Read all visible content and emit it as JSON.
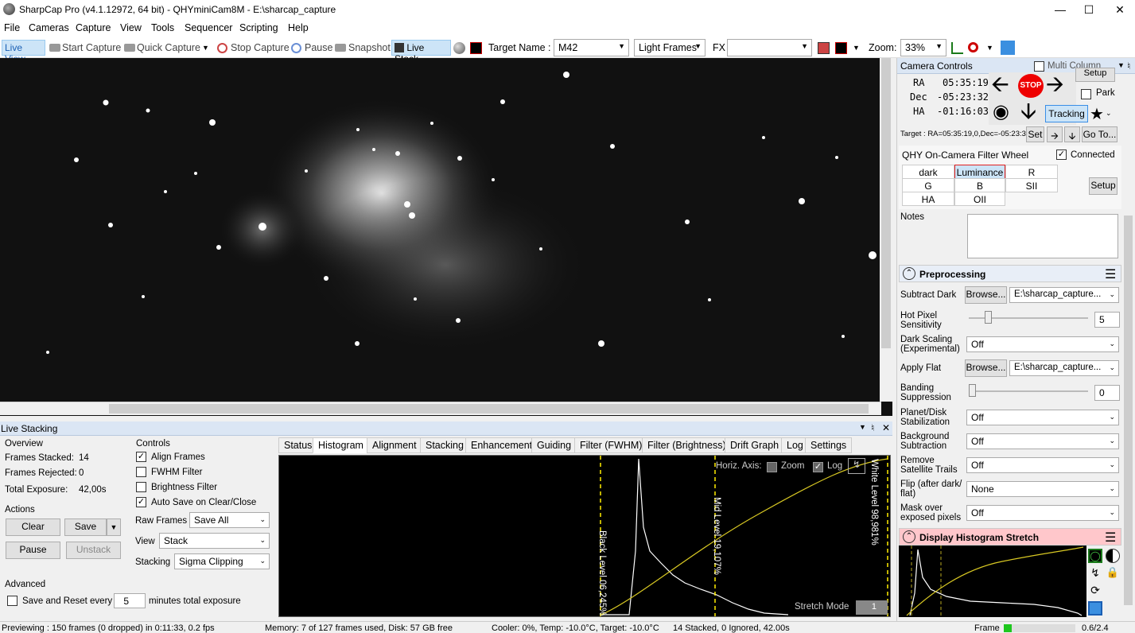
{
  "window": {
    "title": "SharpCap Pro (v4.1.12972, 64 bit) - QHYminiCam8M - E:\\sharcap_capture"
  },
  "menu": [
    "File",
    "Cameras",
    "Capture",
    "View",
    "Tools",
    "Sequencer",
    "Scripting",
    "Help"
  ],
  "toolbar": {
    "live_view": "Live View",
    "start_capture": "Start Capture",
    "quick_capture": "Quick Capture",
    "stop_capture": "Stop Capture",
    "pause": "Pause",
    "snapshot": "Snapshot",
    "live_stack": "Live Stack",
    "target_label": "Target Name :",
    "target_value": "M42",
    "frame_type": "Light Frames",
    "fx_label": "FX",
    "fx_value": "",
    "zoom_label": "Zoom:",
    "zoom_value": "33%"
  },
  "camera_controls": {
    "title": "Camera Controls",
    "multi_column": "Multi Column",
    "ra_label": "RA",
    "ra": "05:35:19",
    "dec_label": "Dec",
    "dec": "-05:23:32",
    "ha_label": "HA",
    "ha": "-01:16:03",
    "stop": "STOP",
    "setup": "Setup",
    "park": "Park",
    "tracking": "Tracking",
    "target": "Target : RA=05:35:19,0,Dec=-05:23:32",
    "set": "Set",
    "goto": "Go To..."
  },
  "filter_wheel": {
    "title": "QHY On-Camera Filter Wheel",
    "connected": "Connected",
    "setup": "Setup",
    "filters": [
      "dark",
      "Luminance",
      "R",
      "G",
      "B",
      "SII",
      "HA",
      "OII"
    ],
    "selected": "Luminance"
  },
  "notes": {
    "label": "Notes"
  },
  "preprocessing": {
    "title": "Preprocessing",
    "subtract_dark_label": "Subtract Dark",
    "browse": "Browse...",
    "dark_path": "E:\\sharcap_capture...",
    "hot_pixel_label": "Hot Pixel Sensitivity",
    "hot_pixel_value": "5",
    "dark_scaling_label": "Dark Scaling (Experimental)",
    "dark_scaling": "Off",
    "apply_flat_label": "Apply Flat",
    "flat_path": "E:\\sharcap_capture...",
    "banding_label": "Banding Suppression",
    "banding_value": "0",
    "planet_label": "Planet/Disk Stabilization",
    "planet": "Off",
    "background_label": "Background Subtraction",
    "background": "Off",
    "satellite_label": "Remove Satellite Trails",
    "satellite": "Off",
    "flip_label": "Flip (after dark/ flat)",
    "flip": "None",
    "mask_label": "Mask over exposed pixels",
    "mask": "Off"
  },
  "display_stretch": {
    "title": "Display Histogram Stretch"
  },
  "live_stacking": {
    "title": "Live Stacking",
    "overview_label": "Overview",
    "frames_stacked_label": "Frames Stacked:",
    "frames_stacked": "14",
    "frames_rejected_label": "Frames Rejected:",
    "frames_rejected": "0",
    "total_exposure_label": "Total Exposure:",
    "total_exposure": "42,00s",
    "actions_label": "Actions",
    "clear": "Clear",
    "save": "Save",
    "pause": "Pause",
    "unstack": "Unstack",
    "advanced_label": "Advanced",
    "save_reset": "Save and Reset every",
    "save_reset_value": "5",
    "minutes": "minutes total exposure",
    "controls_label": "Controls",
    "align_frames": "Align Frames",
    "fwhm_filter": "FWHM Filter",
    "brightness_filter": "Brightness Filter",
    "auto_save": "Auto Save on Clear/Close",
    "raw_frames_label": "Raw Frames",
    "raw_frames": "Save All",
    "view_label": "View",
    "view": "Stack",
    "stacking_label": "Stacking",
    "stacking": "Sigma Clipping",
    "tabs": [
      "Status",
      "Histogram",
      "Alignment",
      "Stacking",
      "Enhancement",
      "Guiding",
      "Filter (FWHM)",
      "Filter (Brightness)",
      "Drift Graph",
      "Log",
      "Settings"
    ],
    "active_tab": "Histogram",
    "horiz_axis": "Horiz. Axis:",
    "zoom": "Zoom",
    "log": "Log",
    "black_level": "Black Level 06,245%",
    "mid_level": "Mid Level 19,107%",
    "white_level": "White Level 98,981%",
    "stretch_mode": "Stretch Mode",
    "stretch_value": "1"
  },
  "status": {
    "preview": "Previewing : 150 frames (0 dropped) in 0:11:33, 0.2 fps",
    "memory": "Memory: 7 of 127 frames used, Disk: 57 GB free",
    "cooler": "Cooler: 0%, Temp: -10.0°C, Target: -10.0°C",
    "stacked": "14 Stacked, 0 Ignored, 42.00s",
    "frame": "Frame",
    "right": "0.6/2.4"
  }
}
